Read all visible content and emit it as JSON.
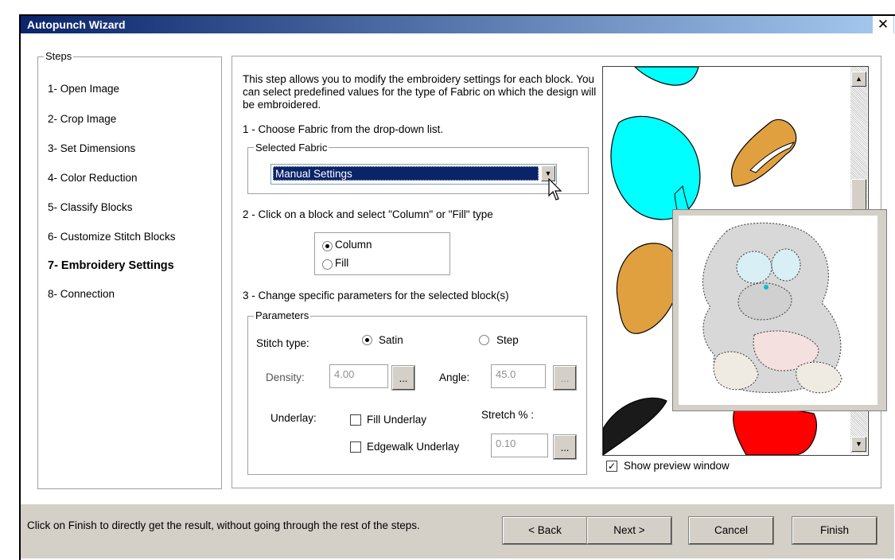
{
  "window": {
    "title": "Autopunch Wizard",
    "close_label": "✕"
  },
  "steps": {
    "legend": "Steps",
    "items": [
      {
        "label": "1- Open Image"
      },
      {
        "label": "2- Crop Image"
      },
      {
        "label": "3- Set Dimensions"
      },
      {
        "label": "4- Color Reduction"
      },
      {
        "label": "5- Classify Blocks"
      },
      {
        "label": "6- Customize Stitch Blocks"
      },
      {
        "label": "7- Embroidery Settings",
        "active": true
      },
      {
        "label": "8- Connection"
      }
    ]
  },
  "main": {
    "intro": "This step allows you to modify the embroidery settings for each block. You can select predefined values for the type of Fabric on which the design will be embroidered.",
    "step1_text": "1 - Choose Fabric from the drop-down list.",
    "fabric_legend": "Selected Fabric",
    "fabric_value": "Manual Settings",
    "step2_text": "2 - Click on a block and select \"Column\" or \"Fill\" type",
    "type_column": "Column",
    "type_fill": "Fill",
    "step3_text": "3 - Change specific parameters for the selected block(s)",
    "params_legend": "Parameters",
    "stitch_type_label": "Stitch type:",
    "stitch_satin": "Satin",
    "stitch_step": "Step",
    "density_label": "Density:",
    "density_value": "4.00",
    "angle_label": "Angle:",
    "angle_value": "45.0",
    "underlay_label": "Underlay:",
    "fill_underlay": "Fill Underlay",
    "edgewalk_underlay": "Edgewalk Underlay",
    "stretch_label": "Stretch % :",
    "stretch_value": "0.10",
    "ellipsis": "..."
  },
  "preview": {
    "show_label": "Show preview window",
    "show_checked": true
  },
  "footer": {
    "hint": "Click on Finish to directly get the result, without going through the rest of the steps.",
    "back_label": "< Back",
    "next_label": "Next >",
    "cancel_label": "Cancel",
    "finish_label": "Finish"
  },
  "colors": {
    "title_start": "#0a246a",
    "title_end": "#a6caf0",
    "cyan": "#00ffff",
    "orange": "#e0a040",
    "red": "#ff0000"
  },
  "icons": {
    "close": "close-icon",
    "dropdown": "chevron-down-icon",
    "scroll_up": "chevron-up-icon",
    "scroll_down": "chevron-down-icon",
    "cursor": "mouse-cursor-icon"
  }
}
